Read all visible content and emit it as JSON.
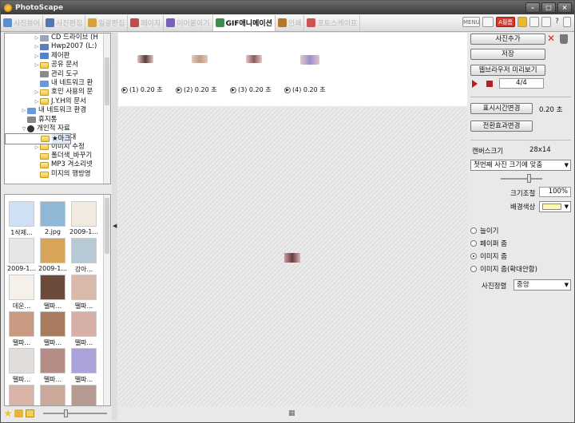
{
  "window": {
    "title": "PhotoScape",
    "controls": [
      "–",
      "□",
      "×"
    ]
  },
  "tabs": [
    {
      "label": "사진뷰어",
      "color": "#5b8fd1",
      "active": false
    },
    {
      "label": "사진편집",
      "color": "#4f77b5",
      "active": false
    },
    {
      "label": "일괄편집",
      "color": "#d9a03a",
      "active": false
    },
    {
      "label": "페이지",
      "color": "#c44b4b",
      "active": false
    },
    {
      "label": "이어붙이기",
      "color": "#7a5fb8",
      "active": false
    },
    {
      "label": "GIF애니메이션",
      "color": "#3e8f4f",
      "active": true
    },
    {
      "label": "인쇄",
      "color": "#b5762e",
      "active": false
    },
    {
      "label": "포토스케이프",
      "color": "#d0524f",
      "active": false
    }
  ],
  "topbar": {
    "menu_label": "MENU",
    "badge_label": "A필름"
  },
  "tree": [
    {
      "label": "CD 드라이브 (H",
      "indent": 36,
      "expand": "▷",
      "icon": "cd"
    },
    {
      "label": "Hwp2007 (L:)",
      "indent": 36,
      "expand": "▷",
      "icon": "drive"
    },
    {
      "label": "제어판",
      "indent": 36,
      "expand": "▷",
      "icon": "panel"
    },
    {
      "label": "공유 문서",
      "indent": 36,
      "expand": "▷",
      "icon": "folder"
    },
    {
      "label": "관리 도구",
      "indent": 36,
      "expand": "",
      "icon": "tool"
    },
    {
      "label": "내 네트워크 환",
      "indent": 36,
      "expand": "",
      "icon": "net"
    },
    {
      "label": "호민 사용의 문",
      "indent": 36,
      "expand": "▷",
      "icon": "folder"
    },
    {
      "label": "J.Y.H의 문서",
      "indent": 36,
      "expand": "▷",
      "icon": "folder"
    },
    {
      "label": "내 네트워크 환경",
      "indent": 20,
      "expand": "▷",
      "icon": "net"
    },
    {
      "label": "휴지통",
      "indent": 20,
      "expand": "",
      "icon": "trash"
    },
    {
      "label": "개인적 자료",
      "indent": 20,
      "expand": "▽",
      "icon": "avatar"
    },
    {
      "label": "★마크",
      "indent": 36,
      "expand": "",
      "icon": "folder",
      "selected": true
    },
    {
      "label": "소녀시대",
      "indent": 36,
      "expand": "▷",
      "icon": "folder"
    },
    {
      "label": "이미지 수정",
      "indent": 36,
      "expand": "▷",
      "icon": "folder"
    },
    {
      "label": "폴더색_바꾸기",
      "indent": 36,
      "expand": "",
      "icon": "folder"
    },
    {
      "label": "MP3 겨소리넷",
      "indent": 36,
      "expand": "",
      "icon": "folder"
    },
    {
      "label": "미지의 행방영",
      "indent": 36,
      "expand": "",
      "icon": "folder"
    }
  ],
  "thumbnails": [
    {
      "caption": "1삭제...",
      "color": "#cfe0f5"
    },
    {
      "caption": "2.jpg",
      "color": "#8fb7d6"
    },
    {
      "caption": "2009-1...",
      "color": "#f1eadf"
    },
    {
      "caption": "2009-1...",
      "color": "#e6e6e6"
    },
    {
      "caption": "2009-1...",
      "color": "#d9a55a"
    },
    {
      "caption": "강아...",
      "color": "#b8c9d6"
    },
    {
      "caption": "데운...",
      "color": "#f5f0ea"
    },
    {
      "caption": "뗄파...",
      "color": "#6b4a3c"
    },
    {
      "caption": "뗄파...",
      "color": "#d9b9a9"
    },
    {
      "caption": "뗄파...",
      "color": "#c99a82"
    },
    {
      "caption": "뗄파...",
      "color": "#a87a5e"
    },
    {
      "caption": "뗄파...",
      "color": "#d6b0a6"
    },
    {
      "caption": "뗄파...",
      "color": "#e1ddda"
    },
    {
      "caption": "뗄파...",
      "color": "#b58c86"
    },
    {
      "caption": "뗄파...",
      "color": "#a9a3d9"
    },
    {
      "caption": "",
      "color": "#d7b3a8"
    },
    {
      "caption": "",
      "color": "#caa99b"
    },
    {
      "caption": "",
      "color": "#b79a92"
    }
  ],
  "frames": [
    {
      "label": "(1) 0.20 초",
      "color": "#5a3a3c"
    },
    {
      "label": "(2) 0.20 초",
      "color": "#c49a82"
    },
    {
      "label": "(3) 0.20 초",
      "color": "#8c5a5e"
    },
    {
      "label": "(4) 0.20 초",
      "color": "#9a8fd0"
    }
  ],
  "controls": {
    "add_photo": "사진추가",
    "save": "저장",
    "browser_preview": "웹브라우저 미리보기",
    "frame_counter": "4/4",
    "display_time_btn": "표시시간변경",
    "display_time_value": "0.20 초",
    "transition_btn": "전환효과변경",
    "canvas_size_label": "캔버스크기",
    "canvas_size_value": "28x14",
    "fit_option": "첫번째 사진 크기에 맞춤",
    "size_label": "크기조절",
    "size_value": "100%",
    "bg_color_label": "배경색상",
    "bg_color": "#fff8b3",
    "radios": [
      {
        "label": "늘이기",
        "checked": false
      },
      {
        "label": "페이퍼 줌",
        "checked": false
      },
      {
        "label": "이미지 줌",
        "checked": true
      },
      {
        "label": "이미지 줌(확대안함)",
        "checked": false
      }
    ],
    "align_label": "사진정렬",
    "align_value": "중앙"
  }
}
